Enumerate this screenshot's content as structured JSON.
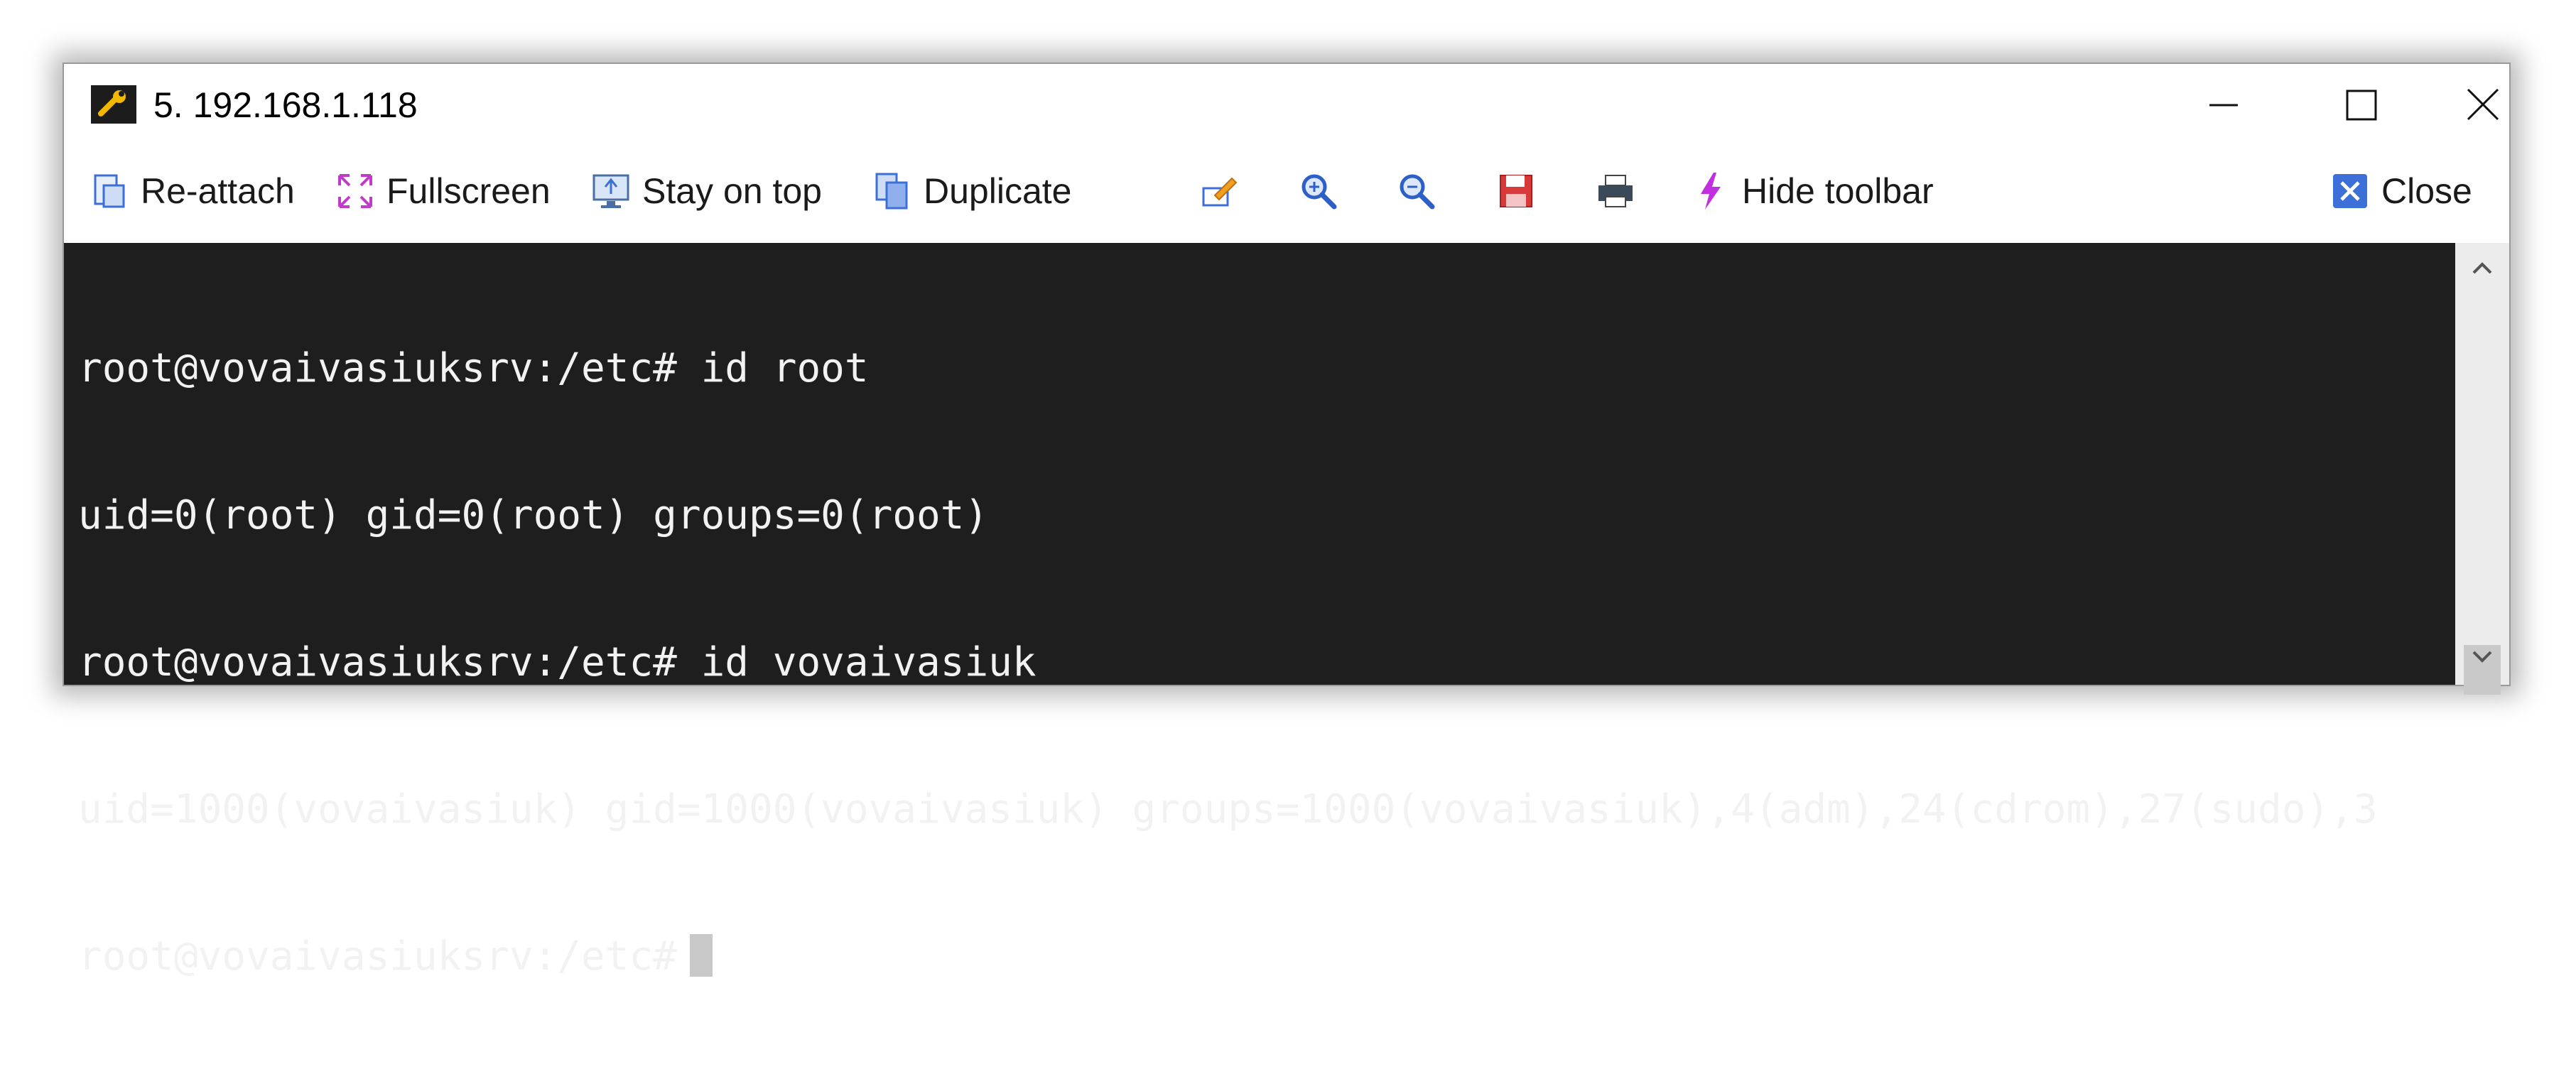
{
  "window": {
    "title": "5. 192.168.1.118"
  },
  "toolbar": {
    "reattach_label": "Re-attach",
    "fullscreen_label": "Fullscreen",
    "stay_on_top_label": "Stay on top",
    "duplicate_label": "Duplicate",
    "hide_toolbar_label": "Hide toolbar",
    "close_label": "Close"
  },
  "terminal": {
    "lines": [
      "root@vovaivasiuksrv:/etc# id root",
      "uid=0(root) gid=0(root) groups=0(root)",
      "root@vovaivasiuksrv:/etc# id vovaivasiuk",
      "uid=1000(vovaivasiuk) gid=1000(vovaivasiuk) groups=1000(vovaivasiuk),4(adm),24(cdrom),27(sudo),3",
      "root@vovaivasiuksrv:/etc#"
    ],
    "background": "#1e1e1e",
    "foreground": "#f2f2f2"
  },
  "icons": {
    "app": "wrench-icon",
    "reattach": "reattach-icon",
    "fullscreen": "fullscreen-icon",
    "stay_on_top": "monitor-icon",
    "duplicate": "duplicate-icon",
    "edit": "pencil-icon",
    "zoom_in": "zoom-in-icon",
    "zoom_out": "zoom-out-icon",
    "save": "floppy-icon",
    "print": "printer-icon",
    "hide_toolbar": "lightning-icon",
    "close": "close-x-icon"
  },
  "colors": {
    "accent": "#3d6fd8",
    "fullscreen": "#c03cc8",
    "save": "#d83a3a",
    "hide_toolbar": "#c030e0"
  }
}
